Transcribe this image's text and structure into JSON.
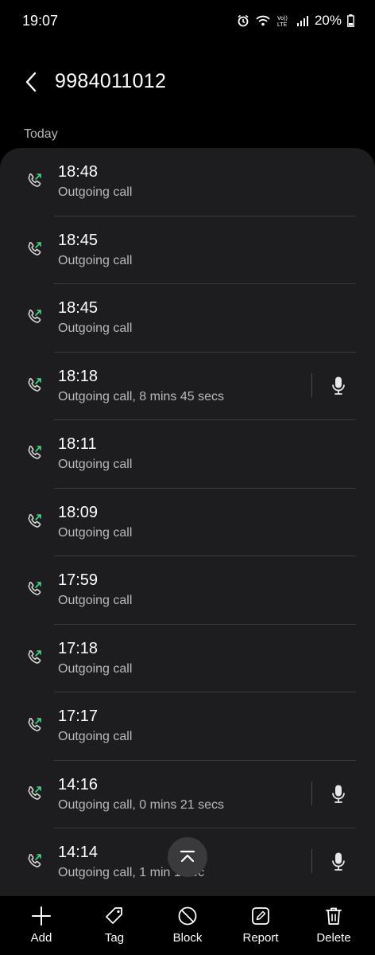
{
  "status_bar": {
    "time": "19:07",
    "battery": "20%"
  },
  "header": {
    "title": "9984011012"
  },
  "section_label": "Today",
  "calls": [
    {
      "time": "18:48",
      "desc": "Outgoing call",
      "recording": false
    },
    {
      "time": "18:45",
      "desc": "Outgoing call",
      "recording": false
    },
    {
      "time": "18:45",
      "desc": "Outgoing call",
      "recording": false
    },
    {
      "time": "18:18",
      "desc": "Outgoing call, 8 mins 45 secs",
      "recording": true
    },
    {
      "time": "18:11",
      "desc": "Outgoing call",
      "recording": false
    },
    {
      "time": "18:09",
      "desc": "Outgoing call",
      "recording": false
    },
    {
      "time": "17:59",
      "desc": "Outgoing call",
      "recording": false
    },
    {
      "time": "17:18",
      "desc": "Outgoing call",
      "recording": false
    },
    {
      "time": "17:17",
      "desc": "Outgoing call",
      "recording": false
    },
    {
      "time": "14:16",
      "desc": "Outgoing call, 0 mins 21 secs",
      "recording": true
    },
    {
      "time": "14:14",
      "desc": "Outgoing call, 1 min 1 sec",
      "recording": true
    }
  ],
  "actions": [
    {
      "label": "Add",
      "icon": "plus-icon"
    },
    {
      "label": "Tag",
      "icon": "tag-icon"
    },
    {
      "label": "Block",
      "icon": "block-icon"
    },
    {
      "label": "Report",
      "icon": "report-icon"
    },
    {
      "label": "Delete",
      "icon": "trash-icon"
    }
  ],
  "colors": {
    "background": "#000000",
    "card": "#1d1d1f",
    "outgoing_arrow": "#3ddc84",
    "secondary_text": "#b9b9b9"
  }
}
